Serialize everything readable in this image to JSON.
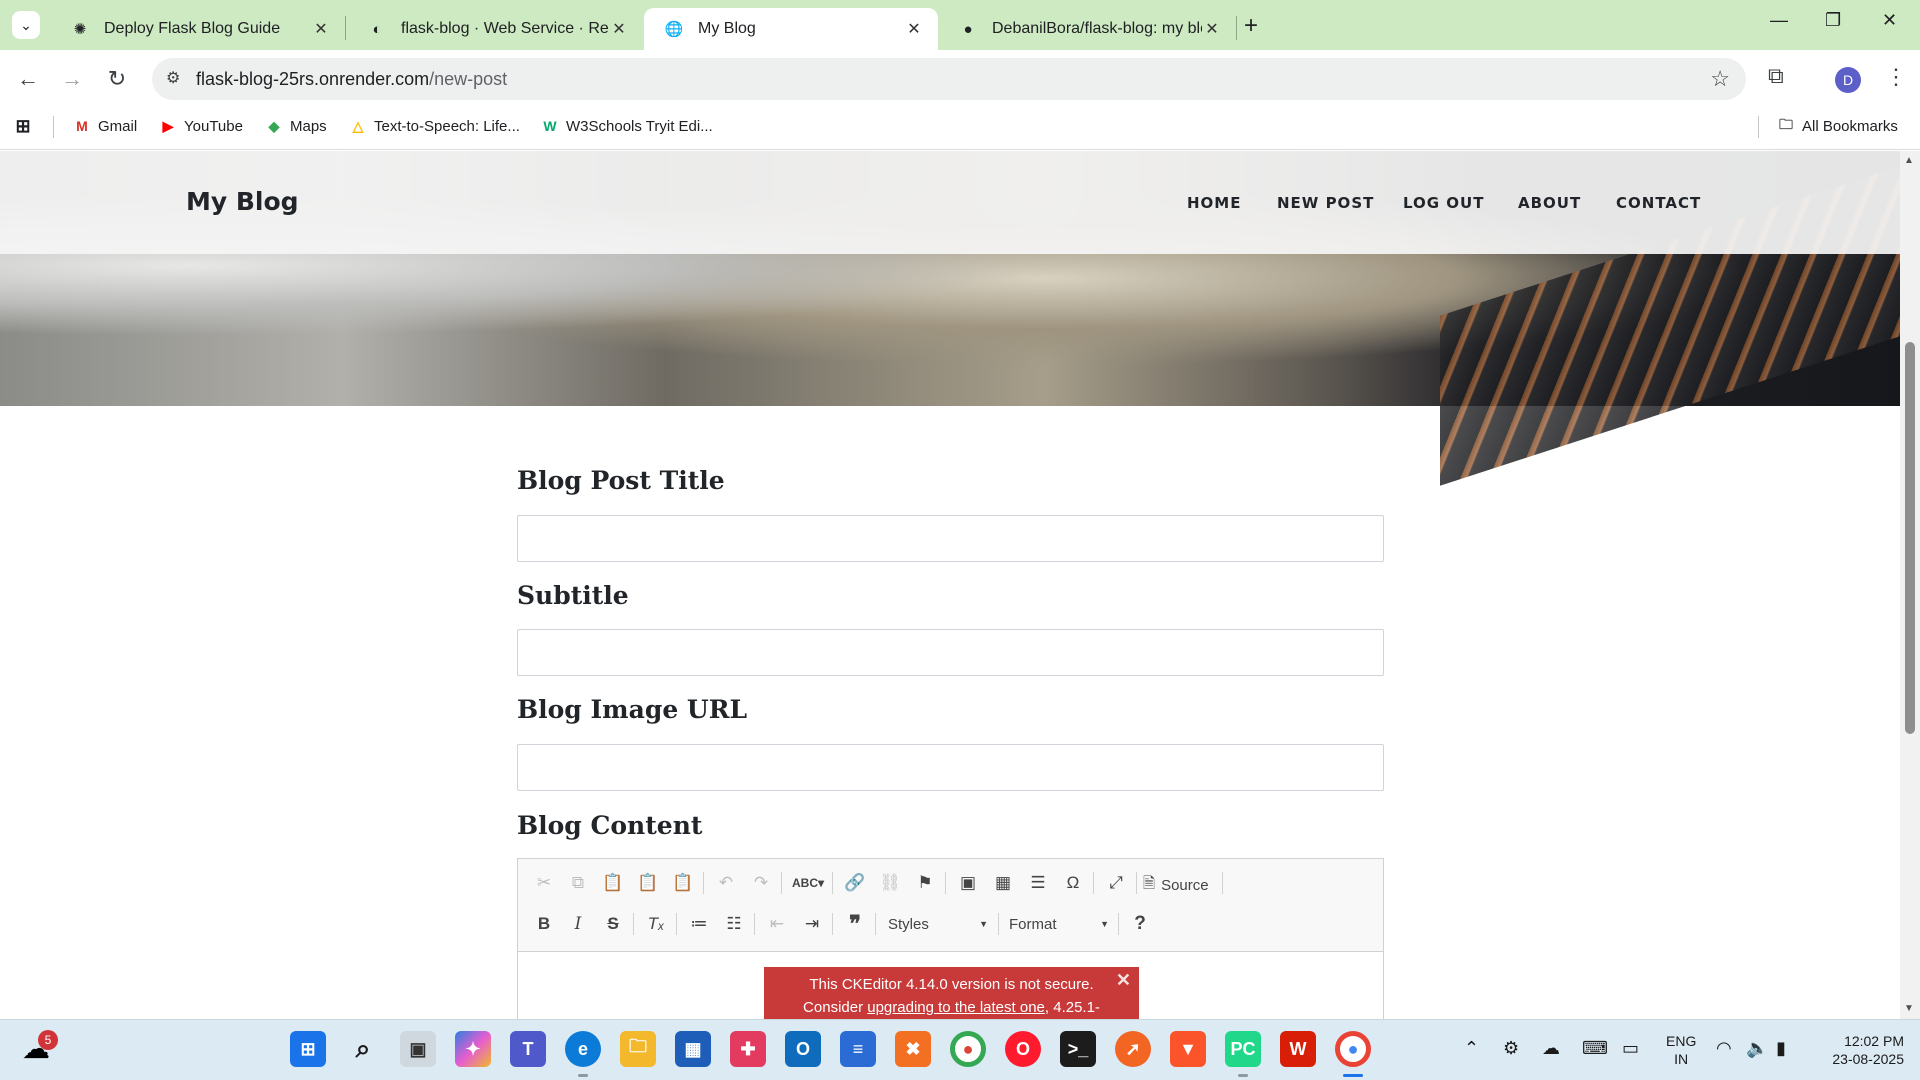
{
  "browser": {
    "tabs": [
      {
        "title": "Deploy Flask Blog Guide",
        "icon": "openai-icon"
      },
      {
        "title": "flask-blog · Web Service · Render",
        "icon": "render-icon"
      },
      {
        "title": "My Blog",
        "icon": "globe-icon",
        "active": true
      },
      {
        "title": "DebanilBora/flask-blog: my blog",
        "icon": "github-icon"
      }
    ],
    "url_host": "flask-blog-25rs.onrender.com",
    "url_path": "/new-post",
    "profile_initial": "D",
    "bookmarks": [
      {
        "label": "Gmail",
        "icon": "gmail-icon",
        "glyph": "M",
        "color": "#d93025"
      },
      {
        "label": "YouTube",
        "icon": "youtube-icon",
        "glyph": "▶",
        "color": "#ff0000"
      },
      {
        "label": "Maps",
        "icon": "maps-icon",
        "glyph": "◆",
        "color": "#34a853"
      },
      {
        "label": "Text-to-Speech: Life...",
        "icon": "tts-icon",
        "glyph": "△",
        "color": "#fbbc04"
      },
      {
        "label": "W3Schools Tryit Edi...",
        "icon": "w3schools-icon",
        "glyph": "W",
        "color": "#04aa6d"
      }
    ],
    "all_bookmarks": "All Bookmarks"
  },
  "site": {
    "brand": "My Blog",
    "nav": [
      "HOME",
      "NEW POST",
      "LOG OUT",
      "ABOUT",
      "CONTACT"
    ]
  },
  "form": {
    "title_label": "Blog Post Title",
    "subtitle_label": "Subtitle",
    "image_label": "Blog Image URL",
    "content_label": "Blog Content",
    "title_value": "",
    "subtitle_value": "",
    "image_value": ""
  },
  "editor": {
    "source_label": "Source",
    "styles_label": "Styles",
    "format_label": "Format",
    "warning_line1": "This CKEditor 4.14.0 version is not secure.",
    "warning_line2_prefix": "Consider ",
    "warning_link": "upgrading to the latest one",
    "warning_line2_suffix": ", 4.25.1-"
  },
  "taskbar": {
    "weather_badge": "5",
    "lang_line1": "ENG",
    "lang_line2": "IN",
    "time": "12:02 PM",
    "date": "23-08-2025"
  }
}
